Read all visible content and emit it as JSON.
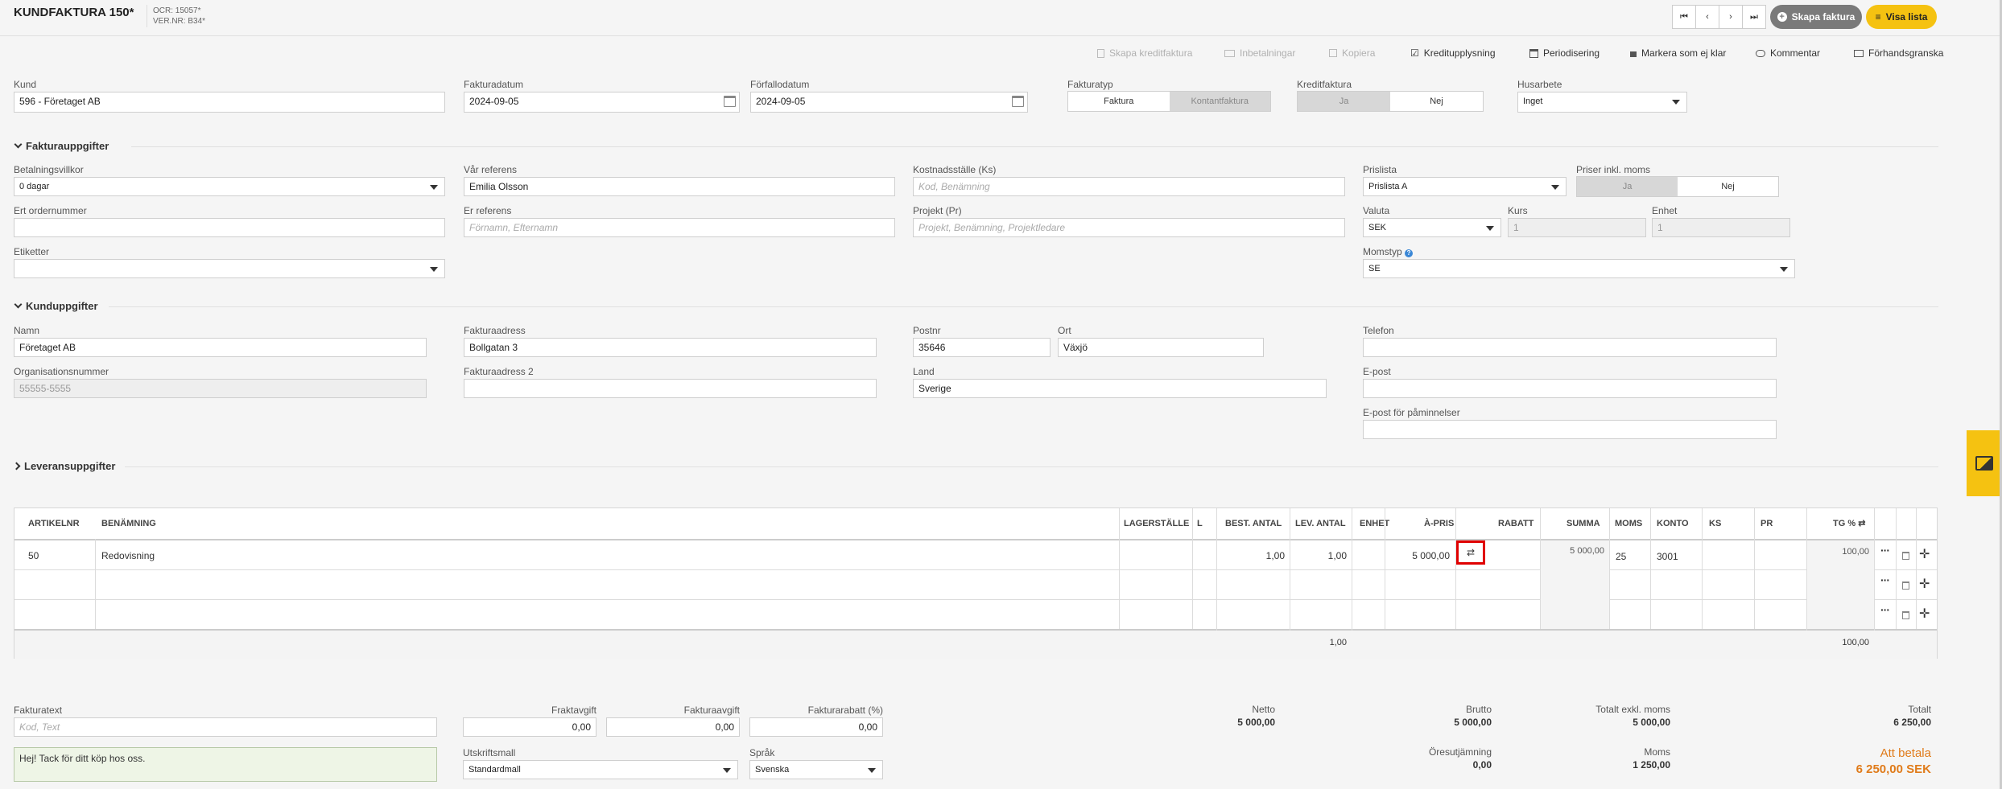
{
  "header": {
    "title": "KUNDFAKTURA 150*",
    "ocr": "OCR: 15057*",
    "ver_nr": "VER.NR: B34*",
    "create_invoice": "Skapa faktura",
    "show_list": "Visa lista"
  },
  "toolbar": {
    "credit_invoice": "Skapa kreditfaktura",
    "payments": "Inbetalningar",
    "copy": "Kopiera",
    "credit_info": "Kreditupplysning",
    "accrual": "Periodisering",
    "mark_unready": "Markera som ej klar",
    "comment": "Kommentar",
    "preview": "Förhandsgranska"
  },
  "top": {
    "kund_label": "Kund",
    "kund_value": "596 - Företaget AB",
    "fakturadatum_label": "Fakturadatum",
    "fakturadatum_value": "2024-09-05",
    "forfallodatum_label": "Förfallodatum",
    "forfallodatum_value": "2024-09-05",
    "fakturatyp_label": "Fakturatyp",
    "fakturatyp_opt1": "Faktura",
    "fakturatyp_opt2": "Kontantfaktura",
    "kreditfaktura_label": "Kreditfaktura",
    "kredit_ja": "Ja",
    "kredit_nej": "Nej",
    "husarbete_label": "Husarbete",
    "husarbete_value": "Inget"
  },
  "invoice_section": {
    "title": "Fakturauppgifter",
    "betalningsvillkor_label": "Betalningsvillkor",
    "betalningsvillkor_value": "0 dagar",
    "var_referens_label": "Vår referens",
    "var_referens_value": "Emilia Olsson",
    "kostnadsstalle_label": "Kostnadsställe (Ks)",
    "kostnadsstalle_placeholder": "Kod, Benämning",
    "prislista_label": "Prislista",
    "prislista_value": "Prislista A",
    "priser_inkl_label": "Priser inkl. moms",
    "priser_ja": "Ja",
    "priser_nej": "Nej",
    "ert_ordernummer_label": "Ert ordernummer",
    "er_referens_label": "Er referens",
    "er_referens_placeholder": "Förnamn, Efternamn",
    "projekt_label": "Projekt (Pr)",
    "projekt_placeholder": "Projekt, Benämning, Projektledare",
    "valuta_label": "Valuta",
    "valuta_value": "SEK",
    "kurs_label": "Kurs",
    "kurs_value": "1",
    "enhet_label": "Enhet",
    "enhet_value": "1",
    "etiketter_label": "Etiketter",
    "momstyp_label": "Momstyp",
    "momstyp_value": "SE"
  },
  "customer_section": {
    "title": "Kunduppgifter",
    "namn_label": "Namn",
    "namn_value": "Företaget AB",
    "fakturaadress_label": "Fakturaadress",
    "fakturaadress_value": "Bollgatan 3",
    "postnr_label": "Postnr",
    "postnr_value": "35646",
    "ort_label": "Ort",
    "ort_value": "Växjö",
    "telefon_label": "Telefon",
    "org_label": "Organisationsnummer",
    "org_value": "55555-5555",
    "fakturaadress2_label": "Fakturaadress 2",
    "land_label": "Land",
    "land_value": "Sverige",
    "epost_label": "E-post",
    "epost_paminnelser_label": "E-post för påminnelser"
  },
  "delivery_section": {
    "title": "Leveransuppgifter"
  },
  "table": {
    "headers": {
      "artikelnr": "ARTIKELNR",
      "benamning": "BENÄMNING",
      "lagerstalle": "LAGERSTÄLLE",
      "l": "L",
      "best_antal": "BEST. ANTAL",
      "lev_antal": "LEV. ANTAL",
      "enhet": "ENHET",
      "a_pris": "À-PRIS",
      "rabatt": "RABATT",
      "summa": "SUMMA",
      "moms": "MOMS",
      "konto": "KONTO",
      "ks": "KS",
      "pr": "PR",
      "tg": "TG %"
    },
    "rows": [
      {
        "artikelnr": "50",
        "benamning": "Redovisning",
        "best_antal": "1,00",
        "lev_antal": "1,00",
        "a_pris": "5 000,00",
        "summa": "5 000,00",
        "moms": "25",
        "konto": "3001",
        "tg": "100,00"
      }
    ],
    "footer": {
      "lev_antal_total": "1,00",
      "tg_total": "100,00"
    }
  },
  "bottom": {
    "fakturatext_label": "Fakturatext",
    "fakturatext_placeholder": "Kod, Text",
    "fakturatext_note": "Hej! Tack för ditt köp hos oss.",
    "fraktavgift_label": "Fraktavgift",
    "fraktavgift_value": "0,00",
    "fakturaavgift_label": "Fakturaavgift",
    "fakturaavgift_value": "0,00",
    "fakturarabatt_label": "Fakturarabatt (%)",
    "fakturarabatt_value": "0,00",
    "utskriftsmall_label": "Utskriftsmall",
    "utskriftsmall_value": "Standardmall",
    "sprak_label": "Språk",
    "sprak_value": "Svenska"
  },
  "totals": {
    "netto_label": "Netto",
    "netto_value": "5 000,00",
    "brutto_label": "Brutto",
    "brutto_value": "5 000,00",
    "totalt_exkl_label": "Totalt exkl. moms",
    "totalt_exkl_value": "5 000,00",
    "totalt_label": "Totalt",
    "totalt_value": "6 250,00",
    "oresutjamning_label": "Öresutjämning",
    "oresutjamning_value": "0,00",
    "moms_label": "Moms",
    "moms_value": "1 250,00",
    "att_betala_label": "Att betala",
    "att_betala_value": "6 250,00 SEK"
  },
  "colors": {
    "accent": "#f5c211",
    "highlight_border": "#e00000",
    "amount_due": "#e07b1a"
  }
}
